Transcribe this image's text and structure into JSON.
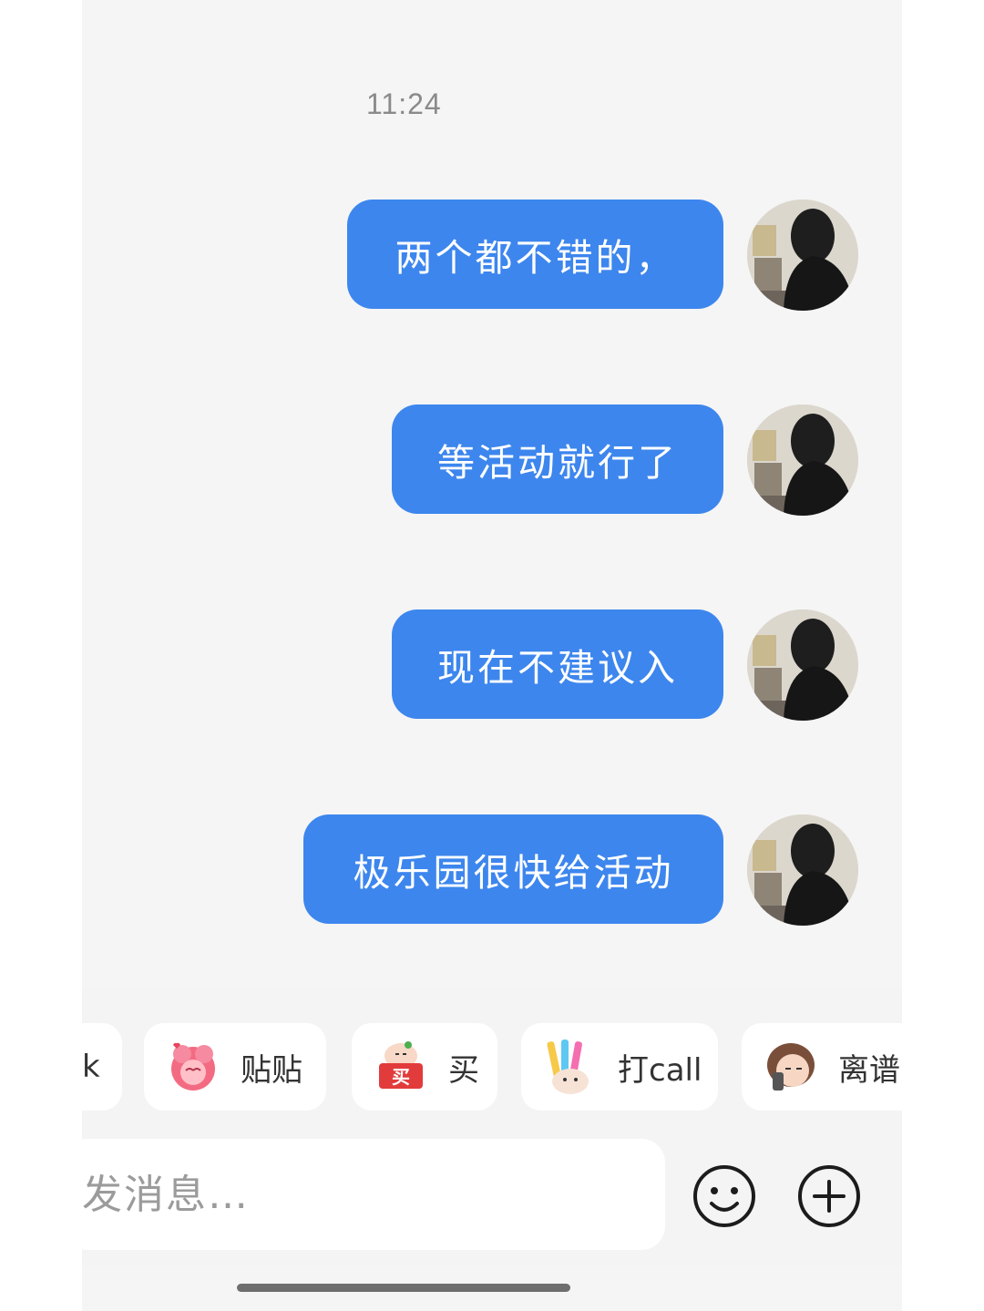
{
  "chat": {
    "timestamp": "11:24",
    "messages": [
      {
        "text": "两个都不错的，",
        "direction": "outgoing"
      },
      {
        "text": "等活动就行了",
        "direction": "outgoing"
      },
      {
        "text": "现在不建议入",
        "direction": "outgoing"
      },
      {
        "text": "极乐园很快给活动",
        "direction": "outgoing"
      }
    ],
    "bubble_color": "#3d86ee"
  },
  "quick_replies": [
    {
      "label": "k",
      "icon": "sticker-partial"
    },
    {
      "label": "贴贴",
      "icon": "pink-hug-sticker"
    },
    {
      "label": "买",
      "icon": "buy-sticker"
    },
    {
      "label": "打call",
      "icon": "glowstick-sticker"
    },
    {
      "label": "离谱",
      "icon": "girl-phone-sticker"
    }
  ],
  "composer": {
    "placeholder": "发消息…",
    "emoji_icon": "smiley-icon",
    "more_icon": "plus-circle-icon"
  }
}
